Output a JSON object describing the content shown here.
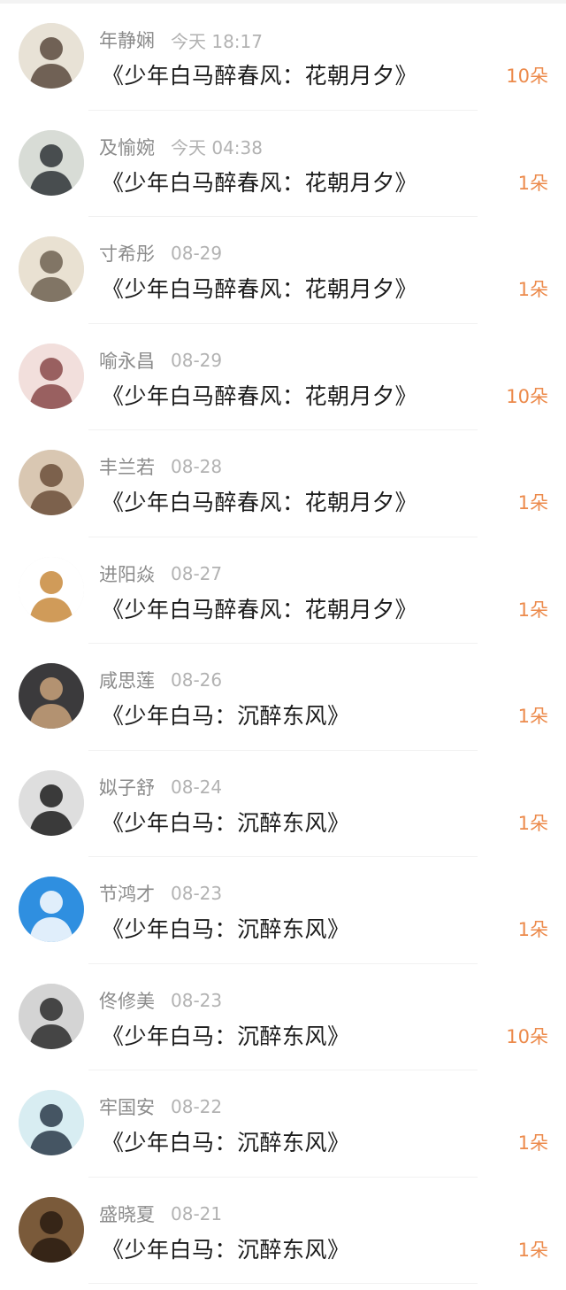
{
  "rows": [
    {
      "name": "年静娴",
      "time": "今天 18:17",
      "title": "《少年白马醉春风：花朝月夕》",
      "amount": "10朵",
      "avatar": {
        "icon": "avatar-ink-portrait-icon",
        "bg": "#e8e2d6",
        "fg": "#5a4a3e"
      }
    },
    {
      "name": "及愉婉",
      "time": "今天 04:38",
      "title": "《少年白马醉春风：花朝月夕》",
      "amount": "1朵",
      "avatar": {
        "icon": "avatar-rabbit-icon",
        "bg": "#d8dcd6",
        "fg": "#2f3437"
      }
    },
    {
      "name": "寸希彤",
      "time": "08-29",
      "title": "《少年白马醉春风：花朝月夕》",
      "amount": "1朵",
      "avatar": {
        "icon": "avatar-sketch-girl-icon",
        "bg": "#e9e1d2",
        "fg": "#6e6252"
      }
    },
    {
      "name": "喻永昌",
      "time": "08-29",
      "title": "《少年白马醉春风：花朝月夕》",
      "amount": "10朵",
      "avatar": {
        "icon": "avatar-face-closeup-icon",
        "bg": "#f2dfdc",
        "fg": "#8a4a4a"
      }
    },
    {
      "name": "丰兰若",
      "time": "08-28",
      "title": "《少年白马醉春风：花朝月夕》",
      "amount": "1朵",
      "avatar": {
        "icon": "avatar-woman-photo-icon",
        "bg": "#d9c7b2",
        "fg": "#6b4f3a"
      }
    },
    {
      "name": "进阳焱",
      "time": "08-27",
      "title": "《少年白马醉春风：花朝月夕》",
      "amount": "1朵",
      "avatar": {
        "icon": "avatar-cartoon-boy-icon",
        "bg": "#ffffff",
        "fg": "#c88a3c"
      }
    },
    {
      "name": "咸思莲",
      "time": "08-26",
      "title": "《少年白马：沉醉东风》",
      "amount": "1朵",
      "avatar": {
        "icon": "avatar-street-photo-icon",
        "bg": "#3b3a3c",
        "fg": "#c9a27a"
      }
    },
    {
      "name": "姒子舒",
      "time": "08-24",
      "title": "《少年白马：沉醉东风》",
      "amount": "1朵",
      "avatar": {
        "icon": "avatar-hiker-silhouette-icon",
        "bg": "#dedede",
        "fg": "#1d1d1d"
      }
    },
    {
      "name": "节鸿才",
      "time": "08-23",
      "title": "《少年白马：沉醉东风》",
      "amount": "1朵",
      "avatar": {
        "icon": "avatar-dolphin-icon",
        "bg": "#2f8fe0",
        "fg": "#ffffff"
      }
    },
    {
      "name": "佟修美",
      "time": "08-23",
      "title": "《少年白马：沉醉东风》",
      "amount": "10朵",
      "avatar": {
        "icon": "avatar-person-gray-icon",
        "bg": "#d4d4d4",
        "fg": "#2b2b2b"
      }
    },
    {
      "name": "牢国安",
      "time": "08-22",
      "title": "《少年白马：沉醉东风》",
      "amount": "1朵",
      "avatar": {
        "icon": "avatar-anime-girl-icon",
        "bg": "#d8edf2",
        "fg": "#2c3a4a"
      }
    },
    {
      "name": "盛晓夏",
      "time": "08-21",
      "title": "《少年白马：沉醉东风》",
      "amount": "1朵",
      "avatar": {
        "icon": "avatar-man-portrait-icon",
        "bg": "#7a5a3a",
        "fg": "#2a1c12"
      }
    }
  ],
  "colors": {
    "amount": "#ec8a4b",
    "name": "#8b8b8b",
    "time": "#b2b2b2",
    "title": "#1b1b1b"
  }
}
